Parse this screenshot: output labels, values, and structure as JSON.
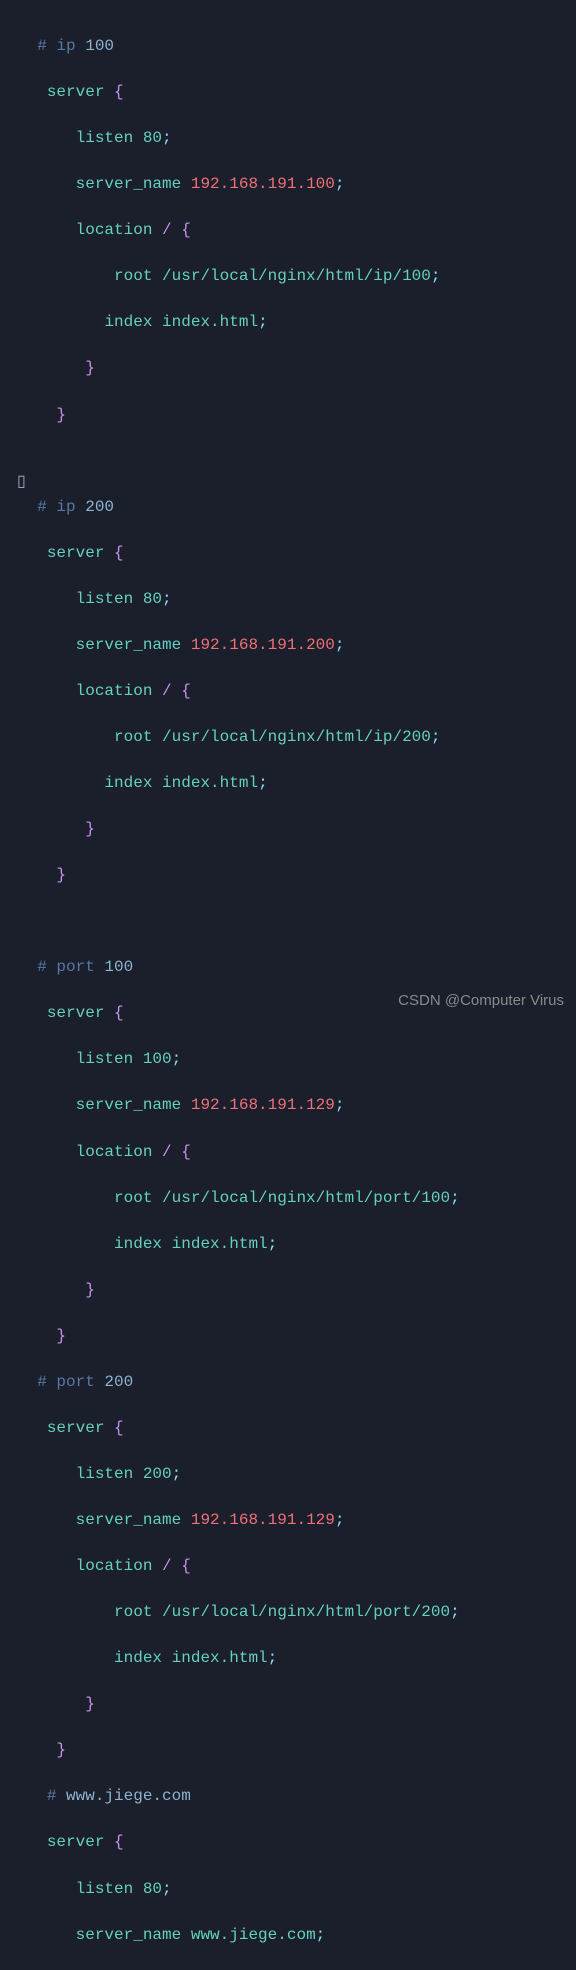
{
  "blocks": [
    {
      "comment_prefix": "# ip ",
      "comment_num": "100",
      "listen": "80",
      "server_name": "192.168.191.100",
      "root": "/usr/local/nginx/html/ip/100",
      "index": "index.html"
    },
    {
      "comment_prefix": "# ip ",
      "comment_num": "200",
      "listen": "80",
      "server_name": "192.168.191.200",
      "root": "/usr/local/nginx/html/ip/200",
      "index": "index.html"
    },
    {
      "comment_prefix": "# port ",
      "comment_num": "100",
      "listen": "100",
      "server_name": "192.168.191.129",
      "root": "/usr/local/nginx/html/port/100",
      "index": "index.html"
    },
    {
      "comment_prefix": "# port ",
      "comment_num": "200",
      "listen": "200",
      "server_name": "192.168.191.129",
      "root": "/usr/local/nginx/html/port/200",
      "index": "index.html"
    }
  ],
  "partial": {
    "comment_prefix": "# ",
    "comment_url": "www.jiege.com",
    "listen": "80",
    "server_name": "www.jiege.com"
  },
  "labels": {
    "server": "server",
    "listen": "listen",
    "server_name": "server_name",
    "location": "location",
    "root": "root",
    "index": "index"
  },
  "watermark": "CSDN @Computer Virus",
  "cursor_char": "[]"
}
